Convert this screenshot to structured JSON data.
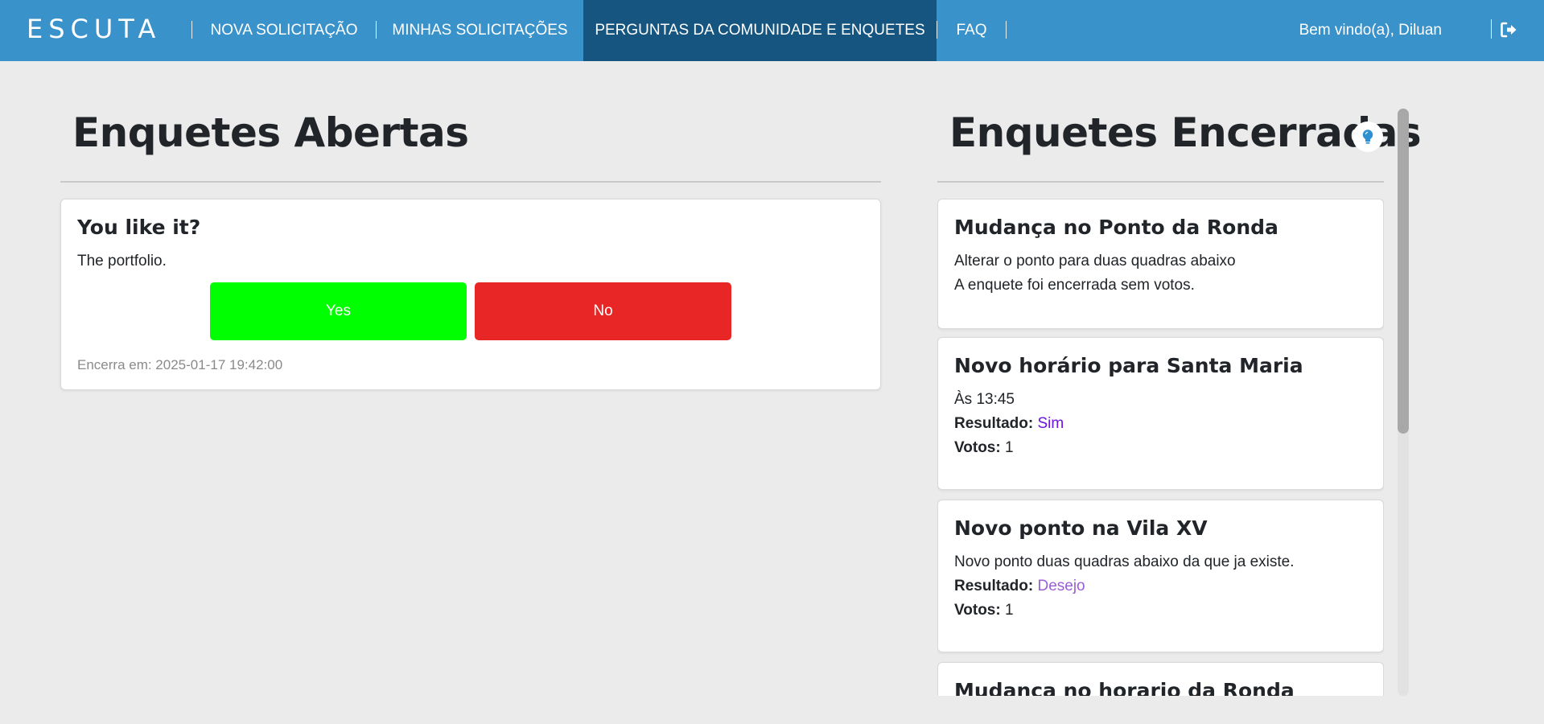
{
  "nav": {
    "logo": "ESCUTA",
    "items": [
      "NOVA SOLICITAÇÃO",
      "MINHAS SOLICITAÇÕES",
      "PERGUNTAS DA COMUNIDADE E ENQUETES",
      "FAQ"
    ],
    "active_index": 2,
    "welcome": "Bem vindo(a), Diluan",
    "logout_icon": "logout-icon"
  },
  "open_polls": {
    "title": "Enquetes Abertas",
    "polls": [
      {
        "question": "You like it?",
        "description": "The portfolio.",
        "yes_label": "Yes",
        "no_label": "No",
        "ends": "Encerra em: 2025-01-17 19:42:00"
      }
    ]
  },
  "closed_polls": {
    "title": "Enquetes Encerradas",
    "hint_icon": "lightbulb-icon",
    "result_label": "Resultado:",
    "votes_label": "Votos:",
    "polls": [
      {
        "title": "Mudança no Ponto da Ronda",
        "description": "Alterar o ponto para duas quadras abaixo",
        "note": "A enquete foi encerrada sem votos."
      },
      {
        "title": "Novo horário para Santa Maria",
        "description": "Às 13:45",
        "result": "Sim",
        "votes": "1"
      },
      {
        "title": "Novo ponto na Vila XV",
        "description": "Novo ponto duas quadras abaixo da que ja existe.",
        "result": "Desejo",
        "votes": "1"
      },
      {
        "title": "Mudança no horario da Ronda"
      }
    ]
  },
  "colors": {
    "navbar": "#3a92cb",
    "nav_active": "#16557f",
    "yes_button": "#00ff00",
    "no_button": "#e92626",
    "result_sim": "#6a12e0",
    "result_desejo": "#9a5ed6"
  }
}
